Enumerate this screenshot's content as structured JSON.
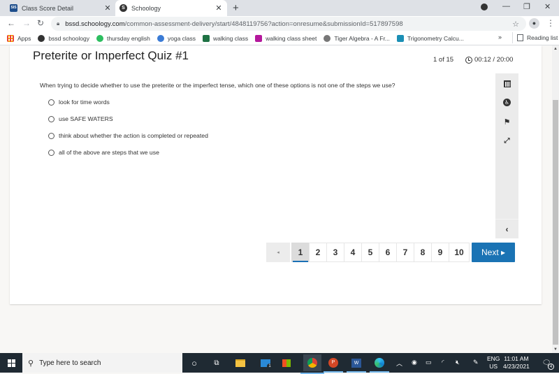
{
  "browser": {
    "tabs": [
      {
        "label": "Class Score Detail",
        "favicon": "SIS",
        "favicon_color": "#1e4e8c",
        "active": false
      },
      {
        "label": "Schoology",
        "favicon": "S",
        "favicon_color": "#333333",
        "active": true
      }
    ],
    "new_tab_label": "+",
    "url_domain": "bssd.schoology.com",
    "url_path": "/common-assessment-delivery/start/4848119756?action=onresume&submissionId=517897598",
    "bookmarks": [
      {
        "label": "Apps",
        "icon": "apps-grid-icon",
        "color": "#ea4335"
      },
      {
        "label": "bssd schoology",
        "icon": "schoology-icon",
        "color": "#333333"
      },
      {
        "label": "thursday english",
        "icon": "evernote-icon",
        "color": "#2dbe60"
      },
      {
        "label": "yoga class",
        "icon": "yoga-icon",
        "color": "#3a7bd5"
      },
      {
        "label": "walking class",
        "icon": "excel-icon",
        "color": "#1f7244"
      },
      {
        "label": "walking class sheet",
        "icon": "sheet-icon",
        "color": "#b4189c"
      },
      {
        "label": "Tiger Algebra - A Fr...",
        "icon": "tiger-icon",
        "color": "#555555"
      },
      {
        "label": "Trigonometry Calcu...",
        "icon": "trig-icon",
        "color": "#1b8fb5"
      }
    ],
    "bookmarks_more": "»",
    "reading_list": "Reading list"
  },
  "quiz": {
    "title": "Preterite or Imperfect Quiz #1",
    "counter": "1 of 15",
    "timer": "00:12 / 20:00",
    "question": "When trying to decide whether to use the preterite or the imperfect tense, which one of these options is not one of the steps we use?",
    "options": [
      "look for time words",
      "use SAFE WATERS",
      "think about whether the action is completed or repeated",
      "all of the above are steps that we use"
    ],
    "tools": [
      "calendar-icon",
      "accessibility-icon",
      "flag-icon",
      "fullscreen-icon"
    ],
    "collapse_label": "‹",
    "pager": {
      "prev": "◂",
      "pages": [
        "1",
        "2",
        "3",
        "4",
        "5",
        "6",
        "7",
        "8",
        "9",
        "10"
      ],
      "current": "1",
      "next": "Next ▸"
    }
  },
  "taskbar": {
    "search_placeholder": "Type here to search",
    "mail_badge": "1",
    "notification_badge": "4",
    "lang_line1": "ENG",
    "lang_line2": "US",
    "time": "11:01 AM",
    "date": "4/23/2021"
  }
}
